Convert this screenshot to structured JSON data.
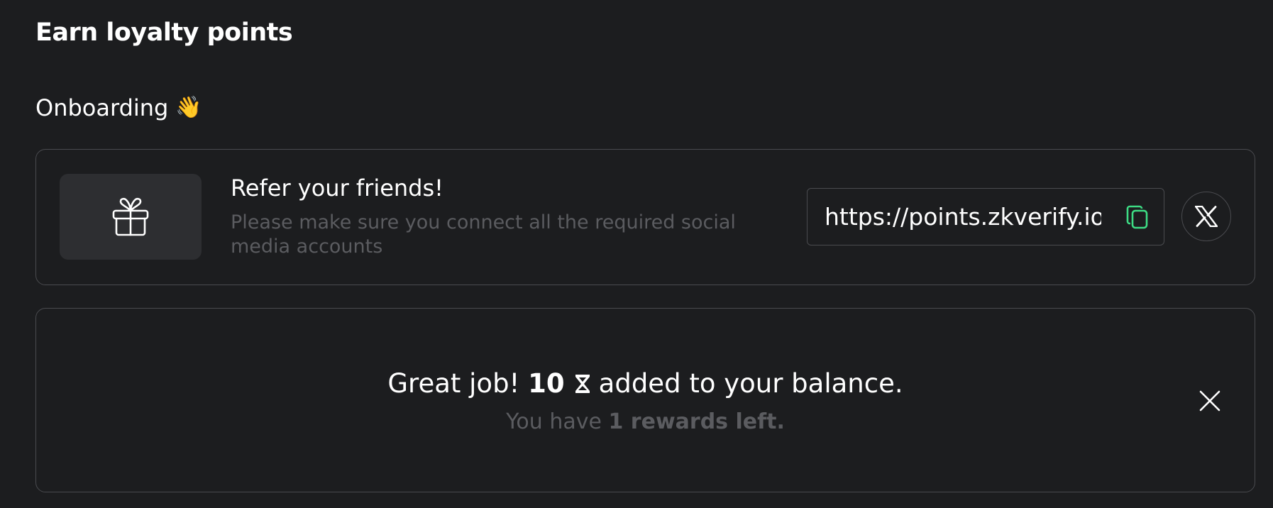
{
  "page": {
    "title": "Earn loyalty points"
  },
  "section": {
    "title": "Onboarding",
    "emoji": "👋",
    "emoji_name": "waving-hand-icon"
  },
  "refer_card": {
    "icon": "gift-icon",
    "title": "Refer your friends!",
    "description": "Please make sure you connect all the required social media accounts",
    "link_value": "https://points.zkverify.io",
    "copy_icon": "copy-icon",
    "share_icon": "x-logo-icon"
  },
  "reward_card": {
    "prefix": "Great job!",
    "amount": "10",
    "amount_icon": "hourglass-icon",
    "suffix": "added to your balance.",
    "sub_prefix": "You have",
    "sub_strong": "1 rewards left.",
    "close_icon": "close-icon"
  },
  "colors": {
    "background": "#1c1d1f",
    "border": "#4a4b4f",
    "muted_text": "#5b5c60",
    "tile_bg": "#2d2e31",
    "accent_green": "#3ddc84"
  }
}
